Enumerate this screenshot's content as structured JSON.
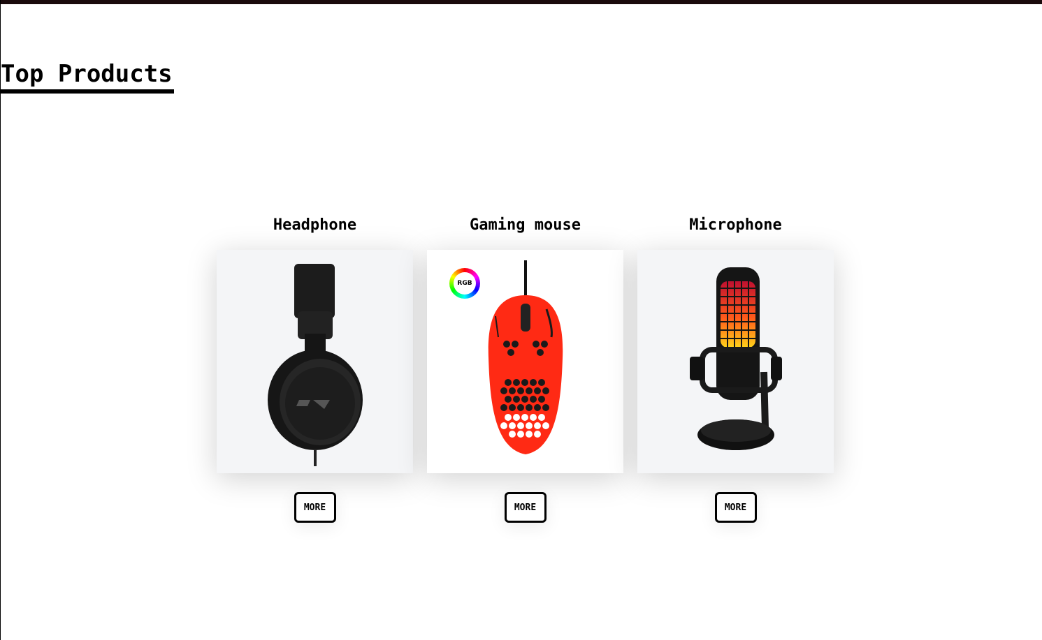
{
  "section": {
    "title": "Top Products"
  },
  "products": [
    {
      "name": "Headphone",
      "button_label": "MORE",
      "icon": "headphone-image"
    },
    {
      "name": "Gaming mouse",
      "button_label": "MORE",
      "icon": "gaming-mouse-image",
      "badge": "RGB"
    },
    {
      "name": "Microphone",
      "button_label": "MORE",
      "icon": "microphone-image"
    }
  ],
  "colors": {
    "top_bar": "#1a0a0c",
    "card_background": "#f4f5f7",
    "mouse_red": "#ff2a14"
  }
}
